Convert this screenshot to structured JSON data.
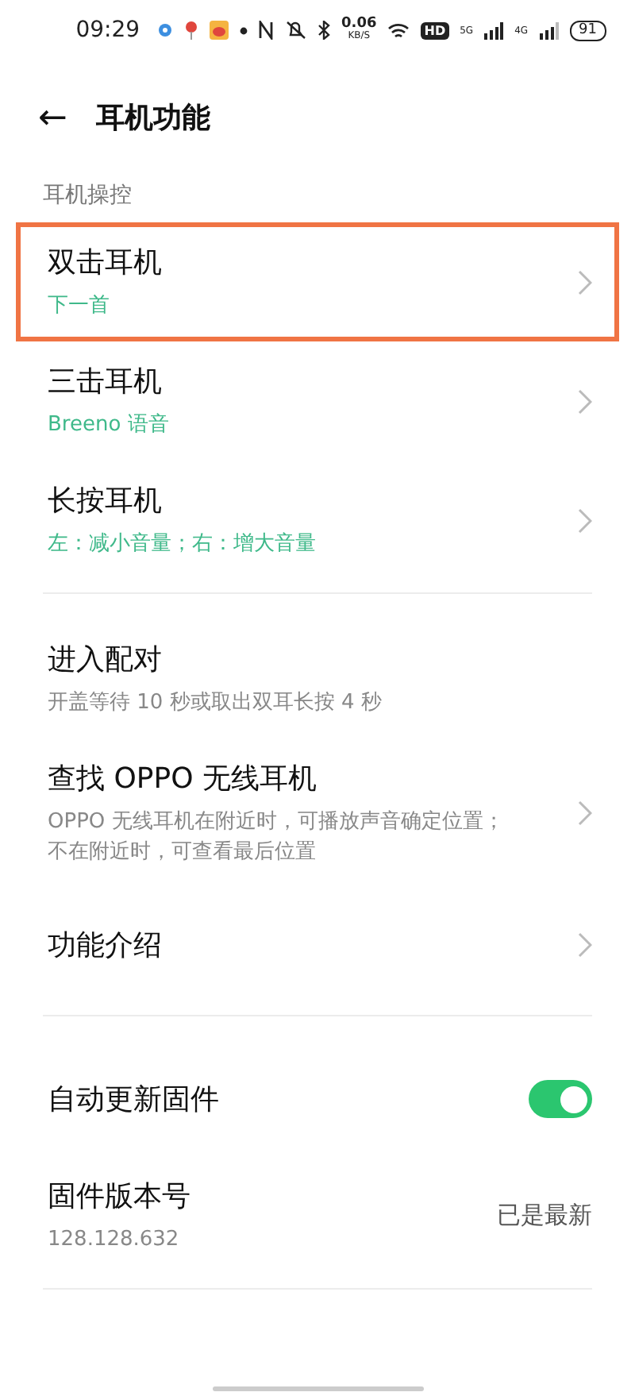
{
  "status_bar": {
    "time": "09:29",
    "speed_value": "0.06",
    "speed_unit": "KB/S",
    "hd": "HD",
    "network_1": "5G",
    "network_2": "4G",
    "battery": "91"
  },
  "header": {
    "back": "←",
    "title": "耳机功能"
  },
  "section": {
    "label": "耳机操控"
  },
  "groups": [
    {
      "items": [
        {
          "title": "双击耳机",
          "subtitle": "下一首",
          "accent": true,
          "chevron": true,
          "highlighted": true
        },
        {
          "title": "三击耳机",
          "subtitle": "Breeno 语音",
          "accent": true,
          "chevron": true,
          "highlighted": false
        },
        {
          "title": "长按耳机",
          "subtitle": "左：减小音量；右：增大音量",
          "accent": true,
          "chevron": true,
          "highlighted": false
        }
      ]
    },
    {
      "items": [
        {
          "title": "进入配对",
          "subtitle": "开盖等待 10 秒或取出双耳长按 4 秒",
          "accent": false,
          "chevron": false,
          "highlighted": false
        },
        {
          "title": "查找 OPPO 无线耳机",
          "subtitle": "OPPO 无线耳机在附近时，可播放声音确定位置；不在附近时，可查看最后位置",
          "accent": false,
          "chevron": true,
          "highlighted": false
        },
        {
          "title": "功能介绍",
          "chevron": true,
          "highlighted": false
        }
      ]
    },
    {
      "items": [
        {
          "title": "自动更新固件",
          "toggle": {
            "on": true
          },
          "chevron": false,
          "highlighted": false
        },
        {
          "title": "固件版本号",
          "subtitle": "128.128.632",
          "accent": false,
          "value": "已是最新",
          "chevron": false,
          "highlighted": false
        }
      ]
    }
  ]
}
